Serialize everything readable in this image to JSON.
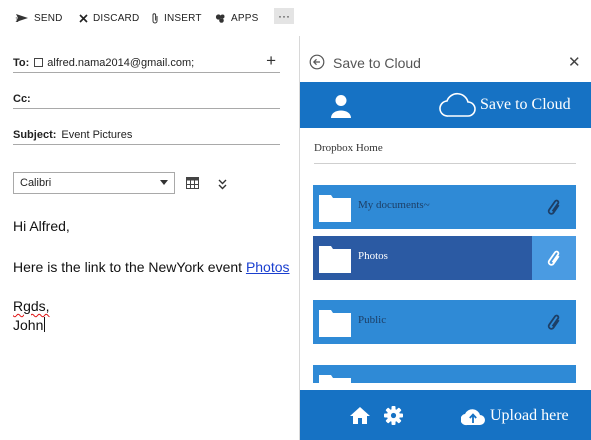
{
  "toolbar": {
    "send": "SEND",
    "discard": "DISCARD",
    "insert": "INSERT",
    "apps": "APPS",
    "more": "···"
  },
  "compose": {
    "to_label": "To:",
    "to_value": "alfred.nama2014@gmail.com;",
    "cc_label": "Cc:",
    "cc_value": "",
    "subject_label": "Subject:",
    "subject_value": "Event Pictures",
    "font": "Calibri",
    "greeting": "Hi Alfred,",
    "body_line": "Here is the link to the NewYork event ",
    "link_text": "Photos",
    "signoff": "Rgds,",
    "signature": "John"
  },
  "pane": {
    "title": "Save to Cloud",
    "banner_title": "Save to Cloud",
    "breadcrumb": "Dropbox Home",
    "folders": [
      {
        "name": "My documents~",
        "selected": false
      },
      {
        "name": "Photos",
        "selected": true
      },
      {
        "name": "Public",
        "selected": false
      },
      {
        "name": "",
        "selected": false
      }
    ],
    "upload_label": "Upload here"
  },
  "colors": {
    "accent_blue": "#1672c4",
    "folder_blue": "#2f8ad6",
    "folder_selected": "#2b5aa3",
    "link": "#1a3fcf"
  },
  "icons": [
    "send-icon",
    "discard-icon",
    "attach-icon",
    "apps-icon",
    "more-icon",
    "add-recipient-icon",
    "table-icon",
    "expand-icon",
    "back-icon",
    "close-icon",
    "user-icon",
    "cloud-icon",
    "folder-icon",
    "paperclip-icon",
    "home-icon",
    "gear-icon",
    "cloud-upload-icon"
  ]
}
